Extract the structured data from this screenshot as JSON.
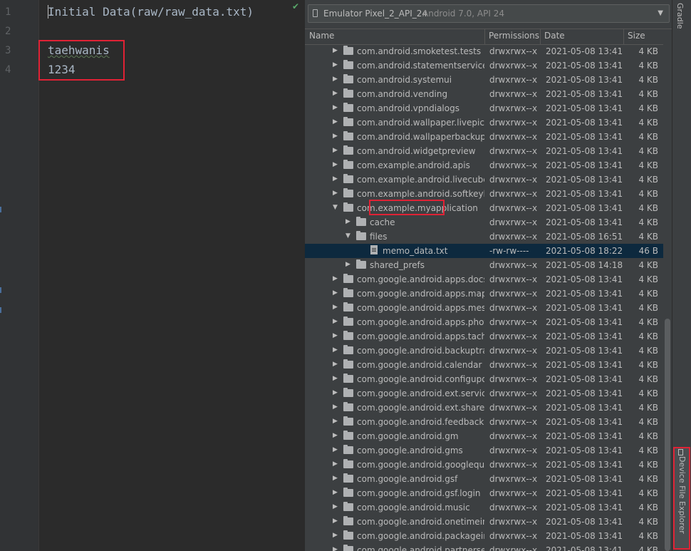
{
  "editor": {
    "line_numbers": [
      "1",
      "2",
      "3",
      "4"
    ],
    "lines": [
      "Initial Data(raw/raw_data.txt)",
      "",
      "taehwanis",
      "1234"
    ]
  },
  "device_select": {
    "name": "Emulator Pixel_2_API_24",
    "detail": "Android 7.0, API 24",
    "icon": "phone-icon"
  },
  "table": {
    "columns": [
      "Name",
      "Permissions",
      "Date",
      "Size"
    ],
    "rows": [
      {
        "name": "com.android.smoketest.tests",
        "perm": "drwxrwx--x",
        "date": "2021-05-08 13:41",
        "size": "4 KB",
        "level": 0,
        "expanded": false,
        "type": "folder"
      },
      {
        "name": "com.android.statementservice",
        "perm": "drwxrwx--x",
        "date": "2021-05-08 13:41",
        "size": "4 KB",
        "level": 0,
        "expanded": false,
        "type": "folder"
      },
      {
        "name": "com.android.systemui",
        "perm": "drwxrwx--x",
        "date": "2021-05-08 13:41",
        "size": "4 KB",
        "level": 0,
        "expanded": false,
        "type": "folder"
      },
      {
        "name": "com.android.vending",
        "perm": "drwxrwx--x",
        "date": "2021-05-08 13:41",
        "size": "4 KB",
        "level": 0,
        "expanded": false,
        "type": "folder"
      },
      {
        "name": "com.android.vpndialogs",
        "perm": "drwxrwx--x",
        "date": "2021-05-08 13:41",
        "size": "4 KB",
        "level": 0,
        "expanded": false,
        "type": "folder"
      },
      {
        "name": "com.android.wallpaper.livepicker",
        "perm": "drwxrwx--x",
        "date": "2021-05-08 13:41",
        "size": "4 KB",
        "level": 0,
        "expanded": false,
        "type": "folder"
      },
      {
        "name": "com.android.wallpaperbackup",
        "perm": "drwxrwx--x",
        "date": "2021-05-08 13:41",
        "size": "4 KB",
        "level": 0,
        "expanded": false,
        "type": "folder"
      },
      {
        "name": "com.android.widgetpreview",
        "perm": "drwxrwx--x",
        "date": "2021-05-08 13:41",
        "size": "4 KB",
        "level": 0,
        "expanded": false,
        "type": "folder"
      },
      {
        "name": "com.example.android.apis",
        "perm": "drwxrwx--x",
        "date": "2021-05-08 13:41",
        "size": "4 KB",
        "level": 0,
        "expanded": false,
        "type": "folder"
      },
      {
        "name": "com.example.android.livecubes",
        "perm": "drwxrwx--x",
        "date": "2021-05-08 13:41",
        "size": "4 KB",
        "level": 0,
        "expanded": false,
        "type": "folder"
      },
      {
        "name": "com.example.android.softkeyboar",
        "perm": "drwxrwx--x",
        "date": "2021-05-08 13:41",
        "size": "4 KB",
        "level": 0,
        "expanded": false,
        "type": "folder"
      },
      {
        "name": "com.example.myapplication",
        "perm": "drwxrwx--x",
        "date": "2021-05-08 13:41",
        "size": "4 KB",
        "level": 0,
        "expanded": true,
        "type": "folder"
      },
      {
        "name": "cache",
        "perm": "drwxrwx--x",
        "date": "2021-05-08 13:41",
        "size": "4 KB",
        "level": 1,
        "expanded": false,
        "type": "folder"
      },
      {
        "name": "files",
        "perm": "drwxrwx--x",
        "date": "2021-05-08 16:51",
        "size": "4 KB",
        "level": 1,
        "expanded": true,
        "type": "folder"
      },
      {
        "name": "memo_data.txt",
        "perm": "-rw-rw----",
        "date": "2021-05-08 18:22",
        "size": "46 B",
        "level": 2,
        "expanded": false,
        "type": "file",
        "selected": true
      },
      {
        "name": "shared_prefs",
        "perm": "drwxrwx--x",
        "date": "2021-05-08 14:18",
        "size": "4 KB",
        "level": 1,
        "expanded": false,
        "type": "folder"
      },
      {
        "name": "com.google.android.apps.docs",
        "perm": "drwxrwx--x",
        "date": "2021-05-08 13:41",
        "size": "4 KB",
        "level": 0,
        "expanded": false,
        "type": "folder"
      },
      {
        "name": "com.google.android.apps.maps",
        "perm": "drwxrwx--x",
        "date": "2021-05-08 13:41",
        "size": "4 KB",
        "level": 0,
        "expanded": false,
        "type": "folder"
      },
      {
        "name": "com.google.android.apps.messag",
        "perm": "drwxrwx--x",
        "date": "2021-05-08 13:41",
        "size": "4 KB",
        "level": 0,
        "expanded": false,
        "type": "folder"
      },
      {
        "name": "com.google.android.apps.photos",
        "perm": "drwxrwx--x",
        "date": "2021-05-08 13:41",
        "size": "4 KB",
        "level": 0,
        "expanded": false,
        "type": "folder"
      },
      {
        "name": "com.google.android.apps.tachyor",
        "perm": "drwxrwx--x",
        "date": "2021-05-08 13:41",
        "size": "4 KB",
        "level": 0,
        "expanded": false,
        "type": "folder"
      },
      {
        "name": "com.google.android.backuptransp",
        "perm": "drwxrwx--x",
        "date": "2021-05-08 13:41",
        "size": "4 KB",
        "level": 0,
        "expanded": false,
        "type": "folder"
      },
      {
        "name": "com.google.android.calendar",
        "perm": "drwxrwx--x",
        "date": "2021-05-08 13:41",
        "size": "4 KB",
        "level": 0,
        "expanded": false,
        "type": "folder"
      },
      {
        "name": "com.google.android.configupdate",
        "perm": "drwxrwx--x",
        "date": "2021-05-08 13:41",
        "size": "4 KB",
        "level": 0,
        "expanded": false,
        "type": "folder"
      },
      {
        "name": "com.google.android.ext.services",
        "perm": "drwxrwx--x",
        "date": "2021-05-08 13:41",
        "size": "4 KB",
        "level": 0,
        "expanded": false,
        "type": "folder"
      },
      {
        "name": "com.google.android.ext.shared",
        "perm": "drwxrwx--x",
        "date": "2021-05-08 13:41",
        "size": "4 KB",
        "level": 0,
        "expanded": false,
        "type": "folder"
      },
      {
        "name": "com.google.android.feedback",
        "perm": "drwxrwx--x",
        "date": "2021-05-08 13:41",
        "size": "4 KB",
        "level": 0,
        "expanded": false,
        "type": "folder"
      },
      {
        "name": "com.google.android.gm",
        "perm": "drwxrwx--x",
        "date": "2021-05-08 13:41",
        "size": "4 KB",
        "level": 0,
        "expanded": false,
        "type": "folder"
      },
      {
        "name": "com.google.android.gms",
        "perm": "drwxrwx--x",
        "date": "2021-05-08 13:41",
        "size": "4 KB",
        "level": 0,
        "expanded": false,
        "type": "folder"
      },
      {
        "name": "com.google.android.googlequicks",
        "perm": "drwxrwx--x",
        "date": "2021-05-08 13:41",
        "size": "4 KB",
        "level": 0,
        "expanded": false,
        "type": "folder"
      },
      {
        "name": "com.google.android.gsf",
        "perm": "drwxrwx--x",
        "date": "2021-05-08 13:41",
        "size": "4 KB",
        "level": 0,
        "expanded": false,
        "type": "folder"
      },
      {
        "name": "com.google.android.gsf.login",
        "perm": "drwxrwx--x",
        "date": "2021-05-08 13:41",
        "size": "4 KB",
        "level": 0,
        "expanded": false,
        "type": "folder"
      },
      {
        "name": "com.google.android.music",
        "perm": "drwxrwx--x",
        "date": "2021-05-08 13:41",
        "size": "4 KB",
        "level": 0,
        "expanded": false,
        "type": "folder"
      },
      {
        "name": "com.google.android.onetimeinitia",
        "perm": "drwxrwx--x",
        "date": "2021-05-08 13:41",
        "size": "4 KB",
        "level": 0,
        "expanded": false,
        "type": "folder"
      },
      {
        "name": "com.google.android.packageinsta",
        "perm": "drwxrwx--x",
        "date": "2021-05-08 13:41",
        "size": "4 KB",
        "level": 0,
        "expanded": false,
        "type": "folder"
      },
      {
        "name": "com.google.android.partnersetup",
        "perm": "drwxrwx--x",
        "date": "2021-05-08 13:41",
        "size": "4 KB",
        "level": 0,
        "expanded": false,
        "type": "folder"
      }
    ]
  },
  "tool_strip": {
    "gradle_label": "Gradle",
    "device_file_explorer_label": "Device File Explorer"
  },
  "colors": {
    "highlight": "#e02235",
    "selection": "#0d293e",
    "editor_bg": "#2b2b2b",
    "panel_bg": "#3c3f41"
  }
}
